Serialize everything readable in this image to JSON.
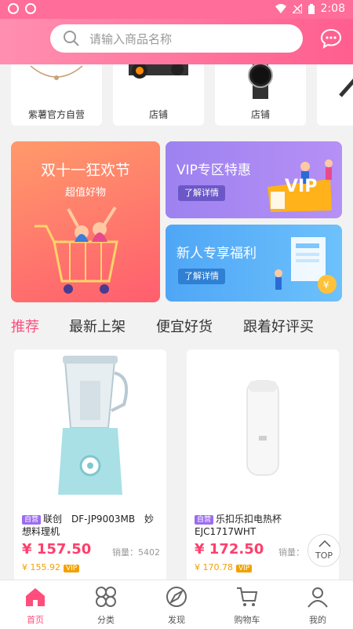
{
  "status": {
    "time": "2:08"
  },
  "search": {
    "placeholder": "请输入商品名称"
  },
  "stores": [
    {
      "name": "紫薯官方自营"
    },
    {
      "name": "店铺"
    },
    {
      "name": "店铺"
    }
  ],
  "banners": {
    "left": {
      "title": "双十一狂欢节",
      "subtitle": "超值好物"
    },
    "vip": {
      "title": "VIP专区特惠",
      "button": "了解详情",
      "badge": "VIP"
    },
    "newcomer": {
      "title": "新人专享福利",
      "button": "了解详情"
    }
  },
  "tabs": [
    "推荐",
    "最新上架",
    "便宜好货",
    "跟着好评买"
  ],
  "products": [
    {
      "badge": "自营",
      "title": "联创　DF-JP9003MB　妙想料理机",
      "price": "¥ 157.50",
      "sales_label": "销量：",
      "sales": "5402",
      "vip_price": "¥ 155.92",
      "vip_tag": "VIP"
    },
    {
      "badge": "自营",
      "title": "乐扣乐扣电热杯EJC1717WHT",
      "price": "¥ 172.50",
      "sales_label": "销量：",
      "sales": "",
      "vip_price": "¥ 170.78",
      "vip_tag": "VIP"
    }
  ],
  "top_button": {
    "label": "TOP"
  },
  "nav": [
    {
      "label": "首页",
      "icon": "home-icon",
      "active": true
    },
    {
      "label": "分类",
      "icon": "category-icon"
    },
    {
      "label": "发现",
      "icon": "discover-icon"
    },
    {
      "label": "购物车",
      "icon": "cart-icon"
    },
    {
      "label": "我的",
      "icon": "profile-icon"
    }
  ],
  "colors": {
    "primary": "#ff4d7c",
    "vip": "#f2a100"
  }
}
